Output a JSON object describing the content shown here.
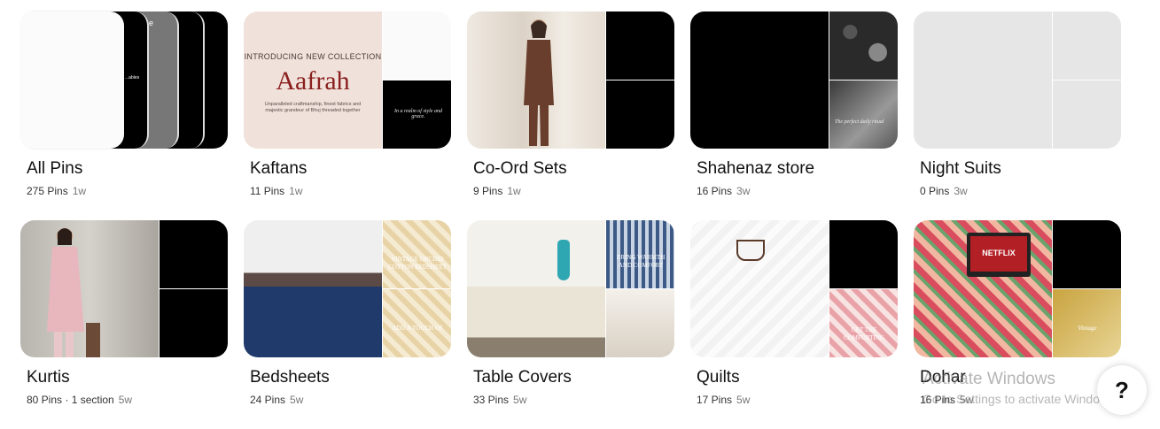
{
  "boards": [
    {
      "title": "All Pins",
      "count": "275 Pins",
      "extra": "",
      "age": "1w"
    },
    {
      "title": "Kaftans",
      "count": "11 Pins",
      "extra": "",
      "age": "1w",
      "cover_text": {
        "intro": "INTRODUCING NEW COLLECTION",
        "name": "Aafrah",
        "sub": "Unparalleled craftmanship, finest fabrics and majestic grandeur of Bhuj threaded together",
        "script": "In a realm of style and grace."
      }
    },
    {
      "title": "Co-Ord Sets",
      "count": "9 Pins",
      "extra": "",
      "age": "1w"
    },
    {
      "title": "Shahenaz store",
      "count": "16 Pins",
      "extra": "",
      "age": "3w",
      "cover_text": {
        "script": "The perfect daily ritual"
      }
    },
    {
      "title": "Night Suits",
      "count": "0 Pins",
      "extra": "",
      "age": "3w"
    },
    {
      "title": "Kurtis",
      "count": "80 Pins",
      "extra": " · 1 section",
      "age": "5w"
    },
    {
      "title": "Bedsheets",
      "count": "24 Pins",
      "extra": "",
      "age": "5w",
      "cover_text": {
        "top": "VINTAGE ORCHID COTTON BEDSHEET",
        "bottom": "ADD A TOUCH OF"
      }
    },
    {
      "title": "Table Covers",
      "count": "33 Pins",
      "extra": "",
      "age": "5w",
      "cover_text": {
        "top": "BRING WARMTH AND COMFORT"
      }
    },
    {
      "title": "Quilts",
      "count": "17 Pins",
      "extra": "",
      "age": "5w",
      "cover_text": {
        "bottom": "GET THE COMFORTING"
      }
    },
    {
      "title": "Dohar",
      "count": "16 Pins",
      "extra": "",
      "age": "5w",
      "cover_text": {
        "netflix": "NETFLIX",
        "script": "Vintage"
      }
    }
  ],
  "all_pins_cover": {
    "text": "...ables",
    "e": "e"
  },
  "watermark": {
    "line1": "Activate Windows",
    "line2": "Go to Settings to activate Windows."
  },
  "help": {
    "label": "?"
  }
}
